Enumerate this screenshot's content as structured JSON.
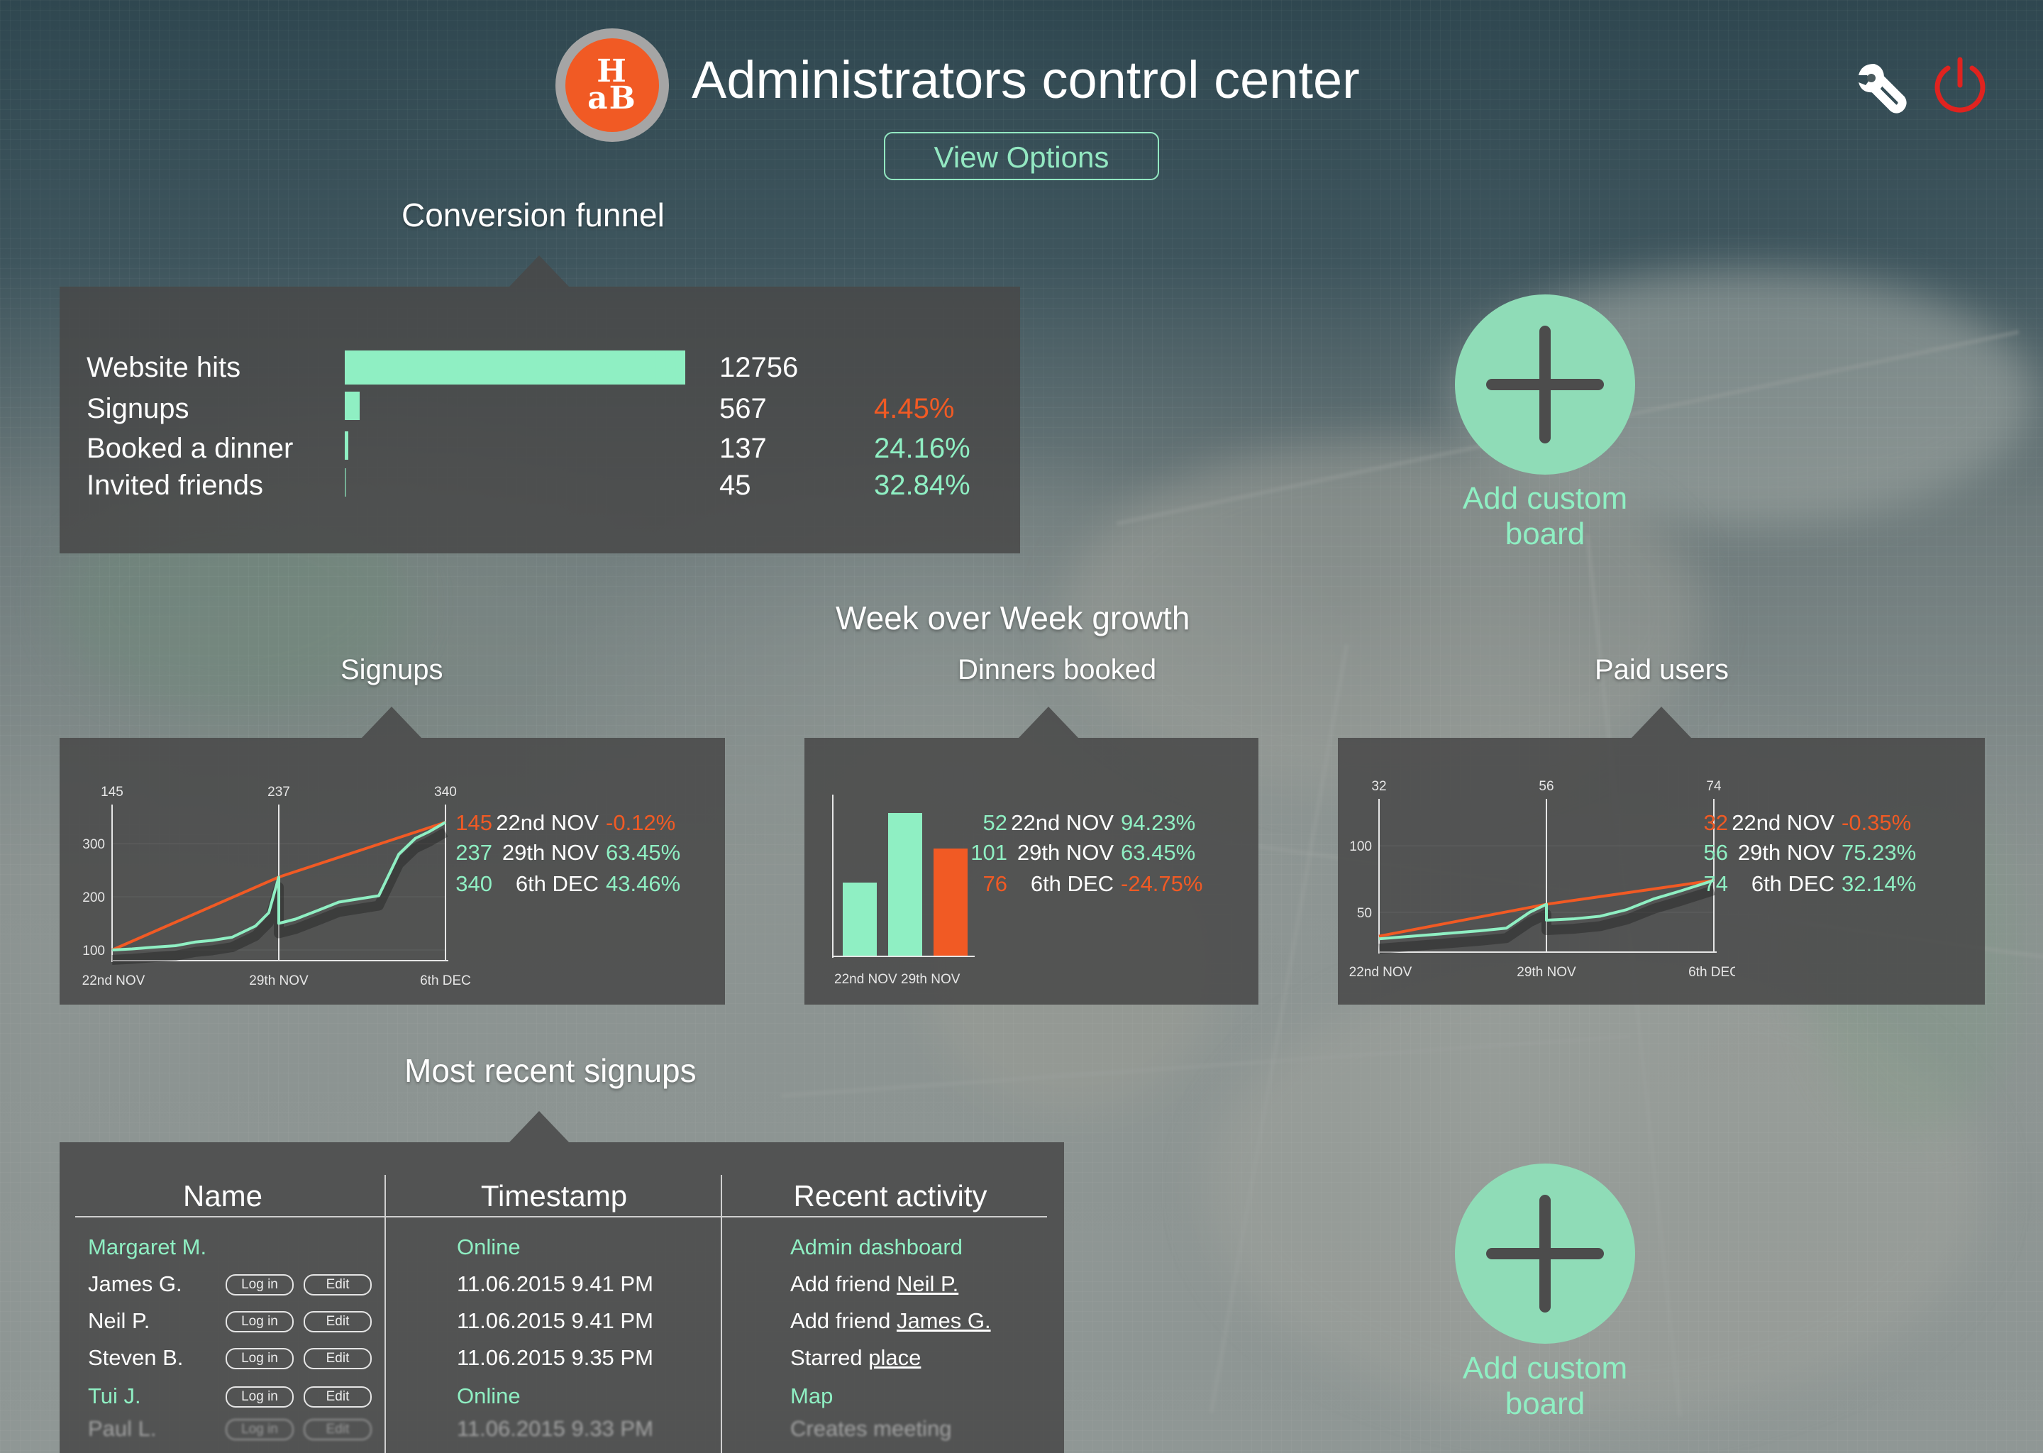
{
  "header": {
    "logo_text_top": "H",
    "logo_text_bottom": "aB",
    "title": "Administrators control center",
    "view_options": "View Options"
  },
  "icons": {
    "settings": "wrench-icon",
    "power": "power-icon",
    "add": "plus-icon"
  },
  "colors": {
    "accent_green": "#8fefc3",
    "accent_orange": "#f15a24",
    "power_red": "#e0231f",
    "panel_bg": "#484848"
  },
  "funnel": {
    "title": "Conversion funnel",
    "rows": [
      {
        "label": "Website hits",
        "value": "12756",
        "pct": "",
        "ratio": 1.0
      },
      {
        "label": "Signups",
        "value": "567",
        "pct": "4.45%",
        "pct_color": "orange",
        "ratio": 0.0445
      },
      {
        "label": "Booked a dinner",
        "value": "137",
        "pct": "24.16%",
        "pct_color": "green",
        "ratio": 0.0107
      },
      {
        "label": "Invited friends",
        "value": "45",
        "pct": "32.84%",
        "pct_color": "green",
        "ratio": 0.0035
      }
    ]
  },
  "add_board": {
    "label_line1": "Add custom",
    "label_line2": "board"
  },
  "growth": {
    "title": "Week over Week growth",
    "signups": {
      "title": "Signups",
      "legend": [
        {
          "value": "145",
          "date": "22nd NOV",
          "change": "-0.12%",
          "value_color": "orange",
          "change_color": "orange"
        },
        {
          "value": "237",
          "date": "29th NOV",
          "change": "63.45%",
          "value_color": "green",
          "change_color": "green"
        },
        {
          "value": "340",
          "date": "6th DEC",
          "change": "43.46%",
          "value_color": "green",
          "change_color": "green"
        }
      ]
    },
    "dinners": {
      "title": "Dinners booked",
      "legend": [
        {
          "value": "52",
          "date": "22nd NOV",
          "change": "94.23%",
          "value_color": "green",
          "change_color": "green"
        },
        {
          "value": "101",
          "date": "29th NOV",
          "change": "63.45%",
          "value_color": "green",
          "change_color": "green"
        },
        {
          "value": "76",
          "date": "6th DEC",
          "change": "-24.75%",
          "value_color": "orange",
          "change_color": "orange"
        }
      ]
    },
    "paid": {
      "title": "Paid users",
      "legend": [
        {
          "value": "32",
          "date": "22nd NOV",
          "change": "-0.35%",
          "value_color": "orange",
          "change_color": "orange"
        },
        {
          "value": "56",
          "date": "29th NOV",
          "change": "75.23%",
          "value_color": "green",
          "change_color": "green"
        },
        {
          "value": "74",
          "date": "6th DEC",
          "change": "32.14%",
          "value_color": "green",
          "change_color": "green"
        }
      ]
    }
  },
  "chart_data": [
    {
      "type": "line",
      "title": "Signups",
      "x_ticks": [
        "22nd NOV",
        "29th NOV",
        "6th DEC"
      ],
      "y_ticks": [
        100,
        200,
        300
      ],
      "top_labels": [
        "145",
        "237",
        "340"
      ],
      "ylim": [
        80,
        360
      ],
      "series": [
        {
          "values_x": [
            0,
            0.5,
            1
          ],
          "values": [
            100,
            237,
            340
          ],
          "color": "#f15a24"
        },
        {
          "values_x": [
            0,
            0.06,
            0.12,
            0.19,
            0.25,
            0.3,
            0.36,
            0.43,
            0.47,
            0.5,
            0.5,
            0.55,
            0.62,
            0.68,
            0.74,
            0.8,
            0.86,
            0.91,
            0.95,
            1.0
          ],
          "values": [
            100,
            102,
            105,
            108,
            115,
            118,
            124,
            145,
            170,
            237,
            150,
            158,
            175,
            190,
            196,
            202,
            280,
            310,
            322,
            340
          ],
          "color": "#8fefc3"
        }
      ]
    },
    {
      "type": "bar",
      "title": "Dinners booked",
      "categories": [
        "22nd NOV",
        "29th NOV",
        "6th DEC"
      ],
      "x_tick_text": "22nd NOV 29th NOV",
      "values": [
        52,
        101,
        76
      ],
      "colors": [
        "#8fefc3",
        "#8fefc3",
        "#f15a24"
      ],
      "ylim": [
        0,
        110
      ]
    },
    {
      "type": "line",
      "title": "Paid users",
      "x_ticks": [
        "22nd NOV",
        "29th NOV",
        "6th DEC"
      ],
      "y_ticks": [
        50,
        100
      ],
      "top_labels": [
        "32",
        "56",
        "74"
      ],
      "ylim": [
        20,
        130
      ],
      "series": [
        {
          "values_x": [
            0,
            0.5,
            1
          ],
          "values": [
            32,
            56,
            74
          ],
          "color": "#f15a24"
        },
        {
          "values_x": [
            0,
            0.1,
            0.2,
            0.3,
            0.38,
            0.45,
            0.5,
            0.5,
            0.58,
            0.66,
            0.74,
            0.82,
            0.9,
            1.0
          ],
          "values": [
            30,
            32,
            34,
            36,
            38,
            50,
            56,
            44,
            45,
            47,
            52,
            60,
            66,
            74
          ],
          "color": "#8fefc3"
        }
      ]
    }
  ],
  "recent_signups": {
    "title": "Most recent signups",
    "columns": [
      "Name",
      "Timestamp",
      "Recent activity"
    ],
    "login_label": "Log in",
    "edit_label": "Edit",
    "rows": [
      {
        "name": "Margaret M.",
        "timestamp": "Online",
        "activity": "Admin dashboard",
        "activity_link": "",
        "highlight": true,
        "buttons": false
      },
      {
        "name": "James G.",
        "timestamp": "11.06.2015 9.41 PM",
        "activity": "Add friend ",
        "activity_link": "Neil P.",
        "highlight": false,
        "buttons": true
      },
      {
        "name": "Neil P.",
        "timestamp": "11.06.2015 9.41 PM",
        "activity": "Add friend ",
        "activity_link": "James G.",
        "highlight": false,
        "buttons": true
      },
      {
        "name": "Steven B.",
        "timestamp": "11.06.2015 9.35 PM",
        "activity": "Starred ",
        "activity_link": "place",
        "highlight": false,
        "buttons": true
      },
      {
        "name": "Tui J.",
        "timestamp": "Online",
        "activity": "Map",
        "activity_link": "",
        "highlight": true,
        "buttons": true
      },
      {
        "name": "Paul L.",
        "timestamp": "11.06.2015 9.33 PM",
        "activity": "Creates meeting",
        "activity_link": "",
        "highlight": false,
        "buttons": true,
        "faded": true
      }
    ]
  }
}
